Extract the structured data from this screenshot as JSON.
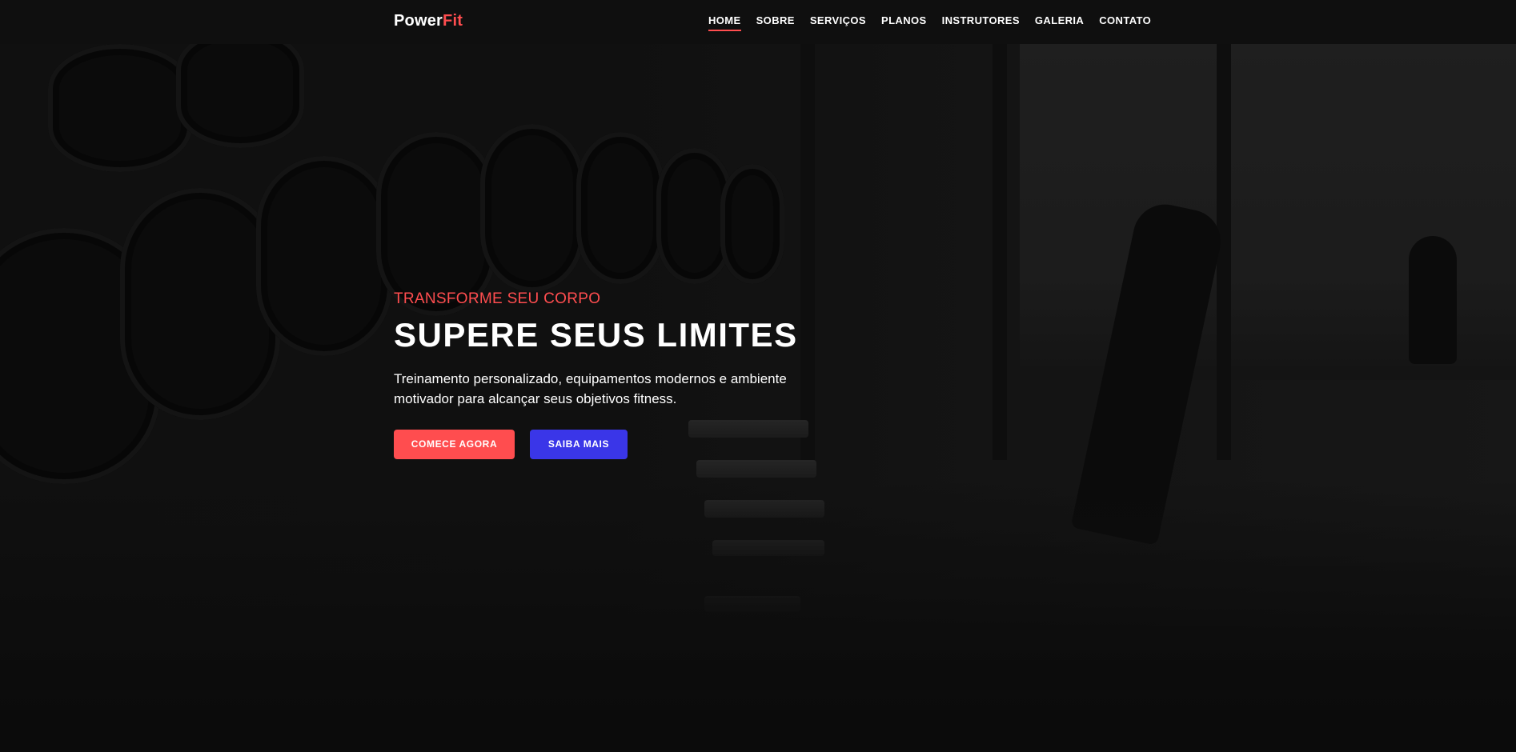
{
  "nav": {
    "logo_main": "Power",
    "logo_accent": "Fit",
    "links": [
      {
        "label": "HOME",
        "active": true
      },
      {
        "label": "SOBRE",
        "active": false
      },
      {
        "label": "SERVIÇOS",
        "active": false
      },
      {
        "label": "PLANOS",
        "active": false
      },
      {
        "label": "INSTRUTORES",
        "active": false
      },
      {
        "label": "GALERIA",
        "active": false
      },
      {
        "label": "CONTATO",
        "active": false
      }
    ]
  },
  "hero": {
    "subtitle": "TRANSFORME SEU CORPO",
    "title": "SUPERE SEUS LIMITES",
    "description": "Treinamento personalizado, equipamentos modernos e ambiente motivador para alcançar seus objetivos fitness.",
    "primary_button": "COMECE AGORA",
    "secondary_button": "SAIBA MAIS"
  },
  "colors": {
    "accent": "#ff4d4f",
    "secondary": "#3a36e8",
    "navbar_bg": "#0f0f0f"
  }
}
